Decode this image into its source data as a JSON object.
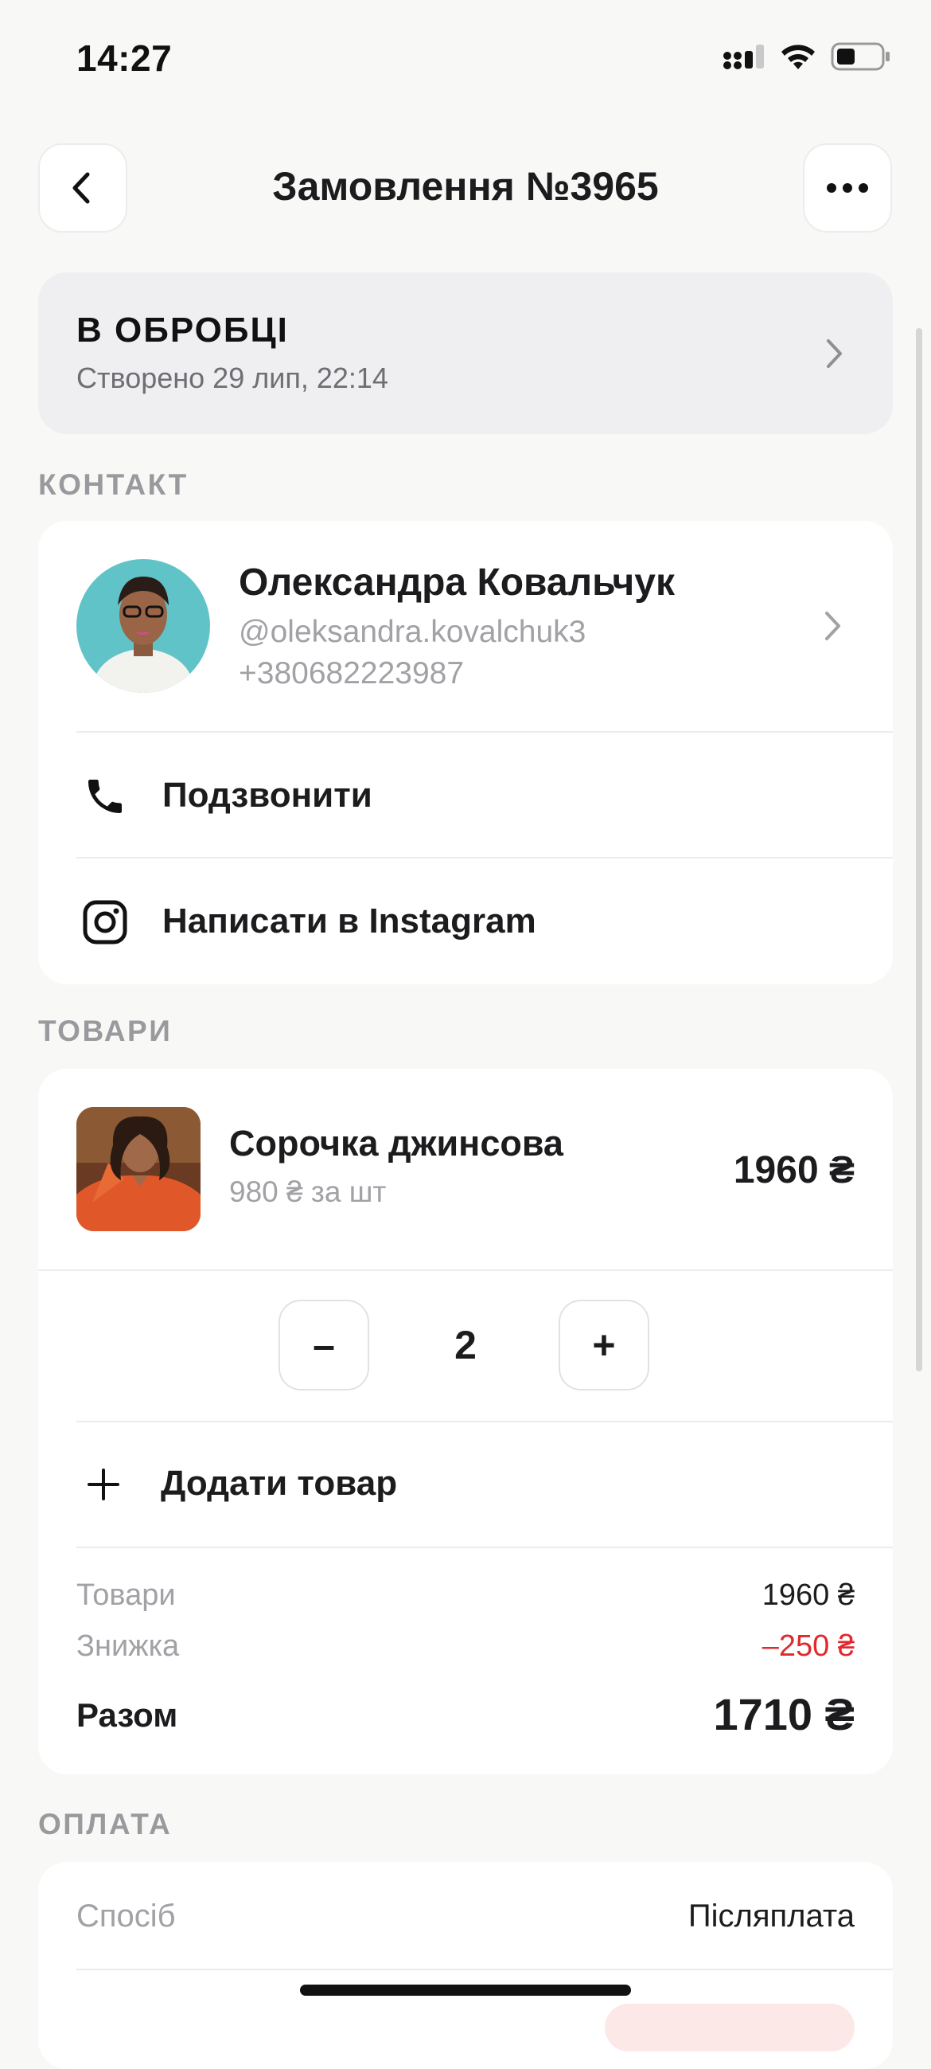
{
  "status_bar": {
    "time": "14:27"
  },
  "header": {
    "title": "Замовлення №3965",
    "back_icon": "chevron-left-icon",
    "more_icon": "more-horizontal-icon"
  },
  "order_status": {
    "label": "В ОБРОБЦІ",
    "created": "Створено 29 лип, 22:14"
  },
  "contact": {
    "section_label": "КОНТАКТ",
    "name": "Олександра Ковальчук",
    "handle": "@oleksandra.kovalchuk3",
    "phone": "+380682223987",
    "call_label": "Подзвонити",
    "instagram_label": "Написати в Instagram"
  },
  "products": {
    "section_label": "ТОВАРИ",
    "items": [
      {
        "name": "Сорочка джинсова",
        "unit_price": "980 ₴ за шт",
        "total": "1960 ₴",
        "quantity": "2"
      }
    ],
    "add_label": "Додати товар",
    "minus": "–",
    "plus": "+"
  },
  "summary": {
    "items_label": "Товари",
    "items_value": "1960 ₴",
    "discount_label": "Знижка",
    "discount_value": "–250 ₴",
    "total_label": "Разом",
    "total_value": "1710 ₴"
  },
  "payment": {
    "section_label": "ОПЛАТА",
    "method_label": "Спосіб",
    "method_value": "Післяплата"
  },
  "colors": {
    "background": "#f8f8f7",
    "card": "#ffffff",
    "status_card": "#efeff2",
    "muted_text": "#a1a1a6",
    "discount": "#e0292f"
  }
}
